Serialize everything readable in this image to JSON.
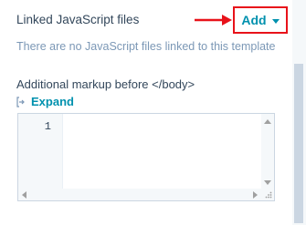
{
  "linked_js": {
    "title": "Linked JavaScript files",
    "add_button_label": "Add",
    "empty_message": "There are no JavaScript files linked to this template"
  },
  "additional_markup": {
    "title": "Additional markup before </body>",
    "expand_label": "Expand",
    "editor": {
      "line_numbers": [
        "1"
      ]
    }
  },
  "colors": {
    "accent": "#0091ae",
    "annotation_red": "#e8121a",
    "text": "#33475b",
    "muted": "#7c98b6"
  },
  "icons": {
    "add_dropdown": "caret-down-icon",
    "expand": "expand-icon",
    "annotation": "red-arrow-icon"
  }
}
